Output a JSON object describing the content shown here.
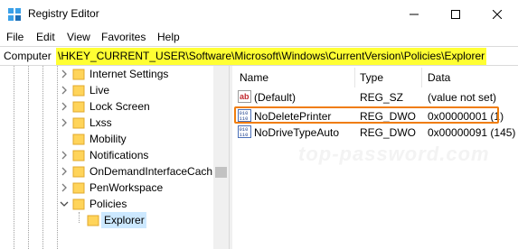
{
  "window": {
    "title": "Registry Editor",
    "controls": [
      "minimize-icon",
      "maximize-icon",
      "close-icon"
    ]
  },
  "menu": [
    "File",
    "Edit",
    "View",
    "Favorites",
    "Help"
  ],
  "address": {
    "prefix": "Computer",
    "path": "\\HKEY_CURRENT_USER\\Software\\Microsoft\\Windows\\CurrentVersion\\Policies\\Explorer",
    "highlight_color": "#ffff33"
  },
  "tree": {
    "items": [
      {
        "label": "Internet Settings",
        "expandable": true
      },
      {
        "label": "Live",
        "expandable": true
      },
      {
        "label": "Lock Screen",
        "expandable": true
      },
      {
        "label": "Lxss",
        "expandable": true
      },
      {
        "label": "Mobility",
        "expandable": false
      },
      {
        "label": "Notifications",
        "expandable": true
      },
      {
        "label": "OnDemandInterfaceCach",
        "expandable": true
      },
      {
        "label": "PenWorkspace",
        "expandable": true
      },
      {
        "label": "Policies",
        "expandable": true,
        "expanded": true
      },
      {
        "label": "Explorer",
        "selected": true
      }
    ]
  },
  "values_list": {
    "columns": [
      "Name",
      "Type",
      "Data"
    ],
    "rows": [
      {
        "name": "(Default)",
        "type": "REG_SZ",
        "data": "(value not set)",
        "icon": "string-value-icon"
      },
      {
        "name": "NoDeletePrinter",
        "type": "REG_DWO",
        "data": "0x00000001 (1)",
        "icon": "binary-value-icon",
        "highlighted": true
      },
      {
        "name": "NoDriveTypeAuto",
        "type": "REG_DWO",
        "data": "0x00000091 (145)",
        "icon": "binary-value-icon"
      }
    ]
  },
  "watermark": "top-password.com",
  "colors": {
    "highlight_box": "#f07d0c",
    "selection": "#cce8ff",
    "folder": "#ffd45a"
  }
}
